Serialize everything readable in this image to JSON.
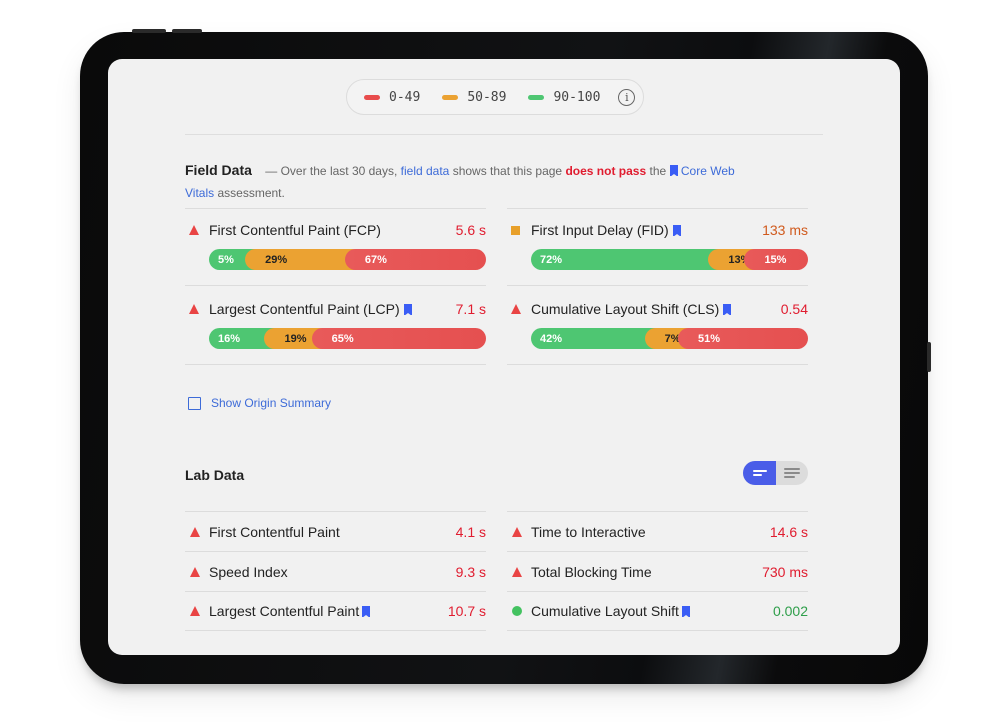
{
  "legend": {
    "items": [
      {
        "label": "0-49",
        "color": "#e84c4c"
      },
      {
        "label": "50-89",
        "color": "#eba232"
      },
      {
        "label": "90-100",
        "color": "#4ec672"
      }
    ],
    "info_icon": "info-icon",
    "info_glyph": "i"
  },
  "field_data": {
    "title": "Field Data",
    "desc_prefix": "— Over the last 30 days,",
    "field_data_link": "field data",
    "desc_mid": "shows that this page",
    "fail_text": "does not pass",
    "desc_the": "the",
    "cwv_link": "Core Web Vitals",
    "desc_suffix": "assessment.",
    "metrics": [
      {
        "name": "First Contentful Paint (FCP)",
        "value": "5.6 s",
        "status": "poor",
        "bookmark": false,
        "distribution": {
          "good": "5%",
          "needs_improvement": "29%",
          "poor": "67%"
        }
      },
      {
        "name": "First Input Delay (FID)",
        "value": "133 ms",
        "status": "average",
        "bookmark": true,
        "distribution": {
          "good": "72%",
          "needs_improvement": "13%",
          "poor": "15%"
        }
      },
      {
        "name": "Largest Contentful Paint (LCP)",
        "value": "7.1 s",
        "status": "poor",
        "bookmark": true,
        "distribution": {
          "good": "16%",
          "needs_improvement": "19%",
          "poor": "65%"
        }
      },
      {
        "name": "Cumulative Layout Shift (CLS)",
        "value": "0.54",
        "status": "poor",
        "bookmark": true,
        "distribution": {
          "good": "42%",
          "needs_improvement": "7%",
          "poor": "51%"
        }
      }
    ],
    "origin_summary_label": "Show Origin Summary",
    "origin_summary_checked": false
  },
  "lab_data": {
    "title": "Lab Data",
    "view_toggle": {
      "active": "compact-view"
    },
    "metrics": [
      {
        "name": "First Contentful Paint",
        "value": "4.1 s",
        "status": "poor",
        "bookmark": false
      },
      {
        "name": "Time to Interactive",
        "value": "14.6 s",
        "status": "poor",
        "bookmark": false
      },
      {
        "name": "Speed Index",
        "value": "9.3 s",
        "status": "poor",
        "bookmark": false
      },
      {
        "name": "Total Blocking Time",
        "value": "730 ms",
        "status": "poor",
        "bookmark": false
      },
      {
        "name": "Largest Contentful Paint",
        "value": "10.7 s",
        "status": "poor",
        "bookmark": true
      },
      {
        "name": "Cumulative Layout Shift",
        "value": "0.002",
        "status": "good",
        "bookmark": true
      }
    ]
  },
  "colors": {
    "poor": "#e01c2f",
    "average": "#d05a1d",
    "good": "#2e9e4a",
    "accent": "#3d6bd8",
    "bookmark": "#3a5df5"
  }
}
